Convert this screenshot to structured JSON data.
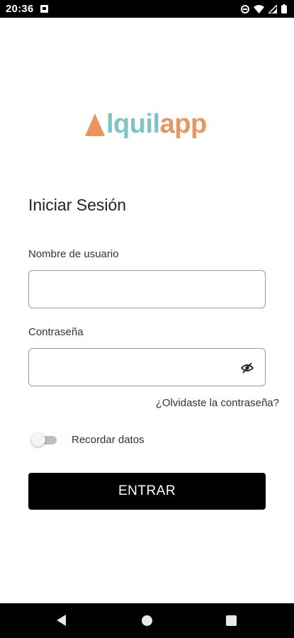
{
  "status_bar": {
    "time": "20:36",
    "icons": [
      "notification-icon",
      "do-not-disturb-icon",
      "wifi-icon",
      "signal-icon",
      "battery-icon"
    ]
  },
  "logo": {
    "part1": "lquil",
    "part2": "app",
    "colors": {
      "orange": "#e8955e",
      "teal": "#7fc4c4"
    }
  },
  "login": {
    "title": "Iniciar Sesión",
    "username_label": "Nombre de usuario",
    "username_value": "",
    "password_label": "Contraseña",
    "password_value": "",
    "forgot_link": "¿Olvidaste la contraseña?",
    "remember_label": "Recordar datos",
    "remember_on": false,
    "submit_label": "ENTRAR"
  },
  "nav_bar": {
    "buttons": [
      "back-icon",
      "home-icon",
      "recents-icon"
    ]
  }
}
